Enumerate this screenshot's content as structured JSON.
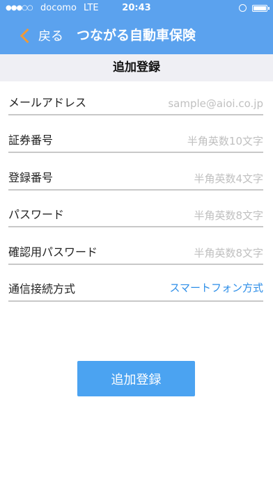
{
  "status_bar": {
    "signal": "●●●○○",
    "carrier": "docomo",
    "network": "LTE",
    "time": "20:43"
  },
  "nav": {
    "back_label": "戻る",
    "title": "つながる自動車保険"
  },
  "section": {
    "title": "追加登録"
  },
  "form": {
    "rows": [
      {
        "label": "メールアドレス",
        "placeholder": "sample@aioi.co.jp"
      },
      {
        "label": "証券番号",
        "placeholder": "半角英数10文字"
      },
      {
        "label": "登録番号",
        "placeholder": "半角英数4文字"
      },
      {
        "label": "パスワード",
        "placeholder": "半角英数8文字"
      },
      {
        "label": "確認用パスワード",
        "placeholder": "半角英数8文字"
      },
      {
        "label": "通信接続方式",
        "value": "スマートフォン方式"
      }
    ]
  },
  "submit": {
    "label": "追加登録"
  },
  "colors": {
    "header_blue": "#5ba2ee",
    "back_arrow_orange": "#ee9a3a",
    "link_blue": "#2d8ee8",
    "button_blue": "#4ba3f1"
  }
}
